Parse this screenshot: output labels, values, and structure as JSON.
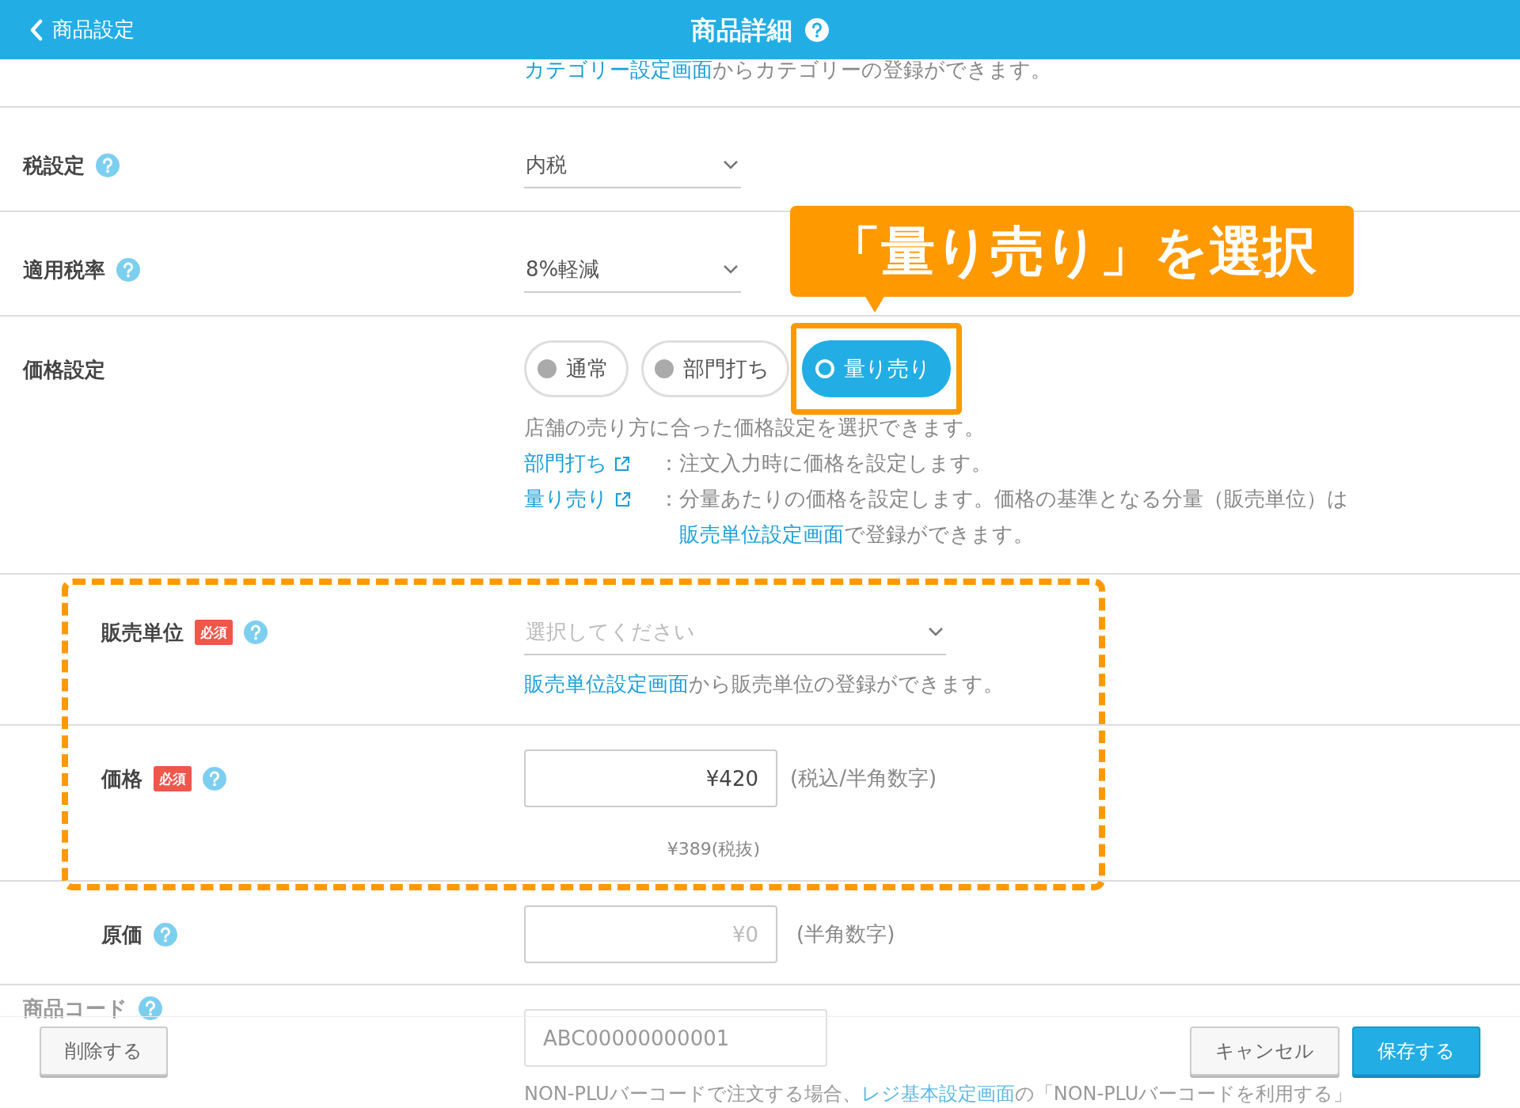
{
  "header": {
    "back_label": "商品設定",
    "title": "商品詳細"
  },
  "category_hint": {
    "link": "カテゴリー設定画面",
    "text": "からカテゴリーの登録ができます。"
  },
  "tax_setting": {
    "label": "税設定",
    "value": "内税"
  },
  "tax_rate": {
    "label": "適用税率",
    "value": "8%軽減"
  },
  "price_setting": {
    "label": "価格設定",
    "options": [
      {
        "label": "通常",
        "selected": false
      },
      {
        "label": "部門打ち",
        "selected": false
      },
      {
        "label": "量り売り",
        "selected": true
      }
    ],
    "description": "店舗の売り方に合った価格設定を選択できます。",
    "notes": [
      {
        "link": "部門打ち",
        "colon": "：",
        "parts": [
          {
            "kind": "text",
            "text": "注文入力時に価格を設定します。"
          }
        ]
      },
      {
        "link": "量り売り",
        "colon": "：",
        "parts": [
          {
            "kind": "text",
            "text": "分量あたりの価格を設定します。価格の基準となる分量（販売単位）は"
          },
          {
            "kind": "link",
            "text": "販売単位設定画面"
          },
          {
            "kind": "text",
            "text": "で登録ができます。"
          }
        ]
      }
    ]
  },
  "sales_unit": {
    "label": "販売単位",
    "required_badge": "必須",
    "placeholder": "選択してください",
    "hint_link": "販売単位設定画面",
    "hint_text": "から販売単位の登録ができます。"
  },
  "price": {
    "label": "価格",
    "required_badge": "必須",
    "value": "¥420",
    "note": "(税込/半角数字)",
    "tax_excluded": "¥389(税抜)"
  },
  "cost": {
    "label": "原価",
    "placeholder": "¥0",
    "note": "(半角数字)"
  },
  "product_code": {
    "label": "商品コード",
    "value": "ABC00000000001",
    "hint_text": "NON-PLUバーコードで注文する場合、",
    "hint_link": "レジ基本設定画面",
    "hint_text_2": "の「NON-PLUバーコードを利用する」"
  },
  "callout": {
    "text": "「量り売り」を選択"
  },
  "footer": {
    "delete": "削除する",
    "cancel": "キャンセル",
    "save": "保存する"
  }
}
